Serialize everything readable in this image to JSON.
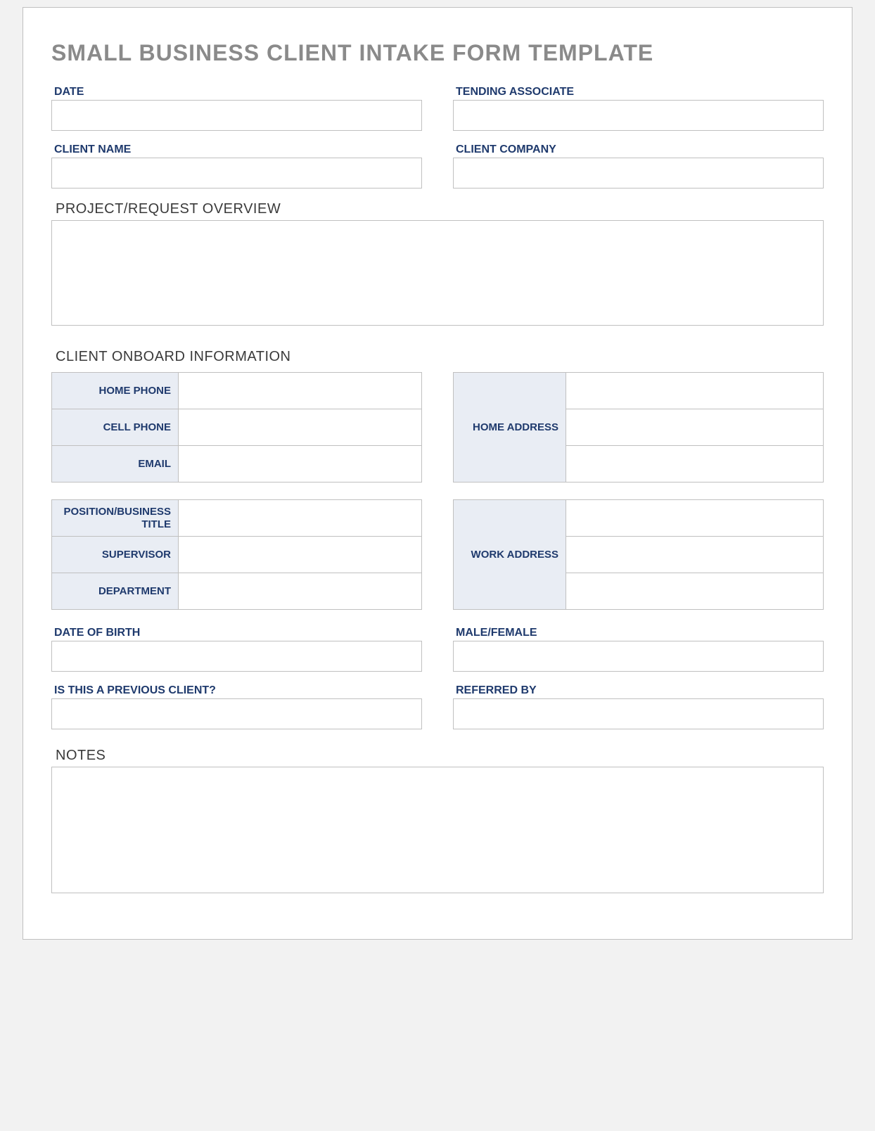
{
  "title": "SMALL BUSINESS CLIENT INTAKE FORM TEMPLATE",
  "top": {
    "date_label": "DATE",
    "associate_label": "TENDING ASSOCIATE",
    "client_name_label": "CLIENT NAME",
    "client_company_label": "CLIENT COMPANY",
    "date": "",
    "associate": "",
    "client_name": "",
    "client_company": ""
  },
  "overview": {
    "heading": "PROJECT/REQUEST OVERVIEW",
    "value": ""
  },
  "onboard": {
    "heading": "CLIENT ONBOARD INFORMATION",
    "home_phone_label": "HOME PHONE",
    "cell_phone_label": "CELL PHONE",
    "email_label": "EMAIL",
    "home_address_label": "HOME ADDRESS",
    "position_label": "POSITION/BUSINESS TITLE",
    "supervisor_label": "SUPERVISOR",
    "department_label": "DEPARTMENT",
    "work_address_label": "WORK ADDRESS",
    "home_phone": "",
    "cell_phone": "",
    "email": "",
    "home_address1": "",
    "home_address2": "",
    "home_address3": "",
    "position": "",
    "supervisor": "",
    "department": "",
    "work_address1": "",
    "work_address2": "",
    "work_address3": ""
  },
  "extra": {
    "dob_label": "DATE OF BIRTH",
    "sex_label": "MALE/FEMALE",
    "prev_label": "IS THIS A PREVIOUS CLIENT?",
    "ref_label": "REFERRED BY",
    "dob": "",
    "sex": "",
    "previous": "",
    "referred": ""
  },
  "notes": {
    "heading": "NOTES",
    "value": ""
  }
}
